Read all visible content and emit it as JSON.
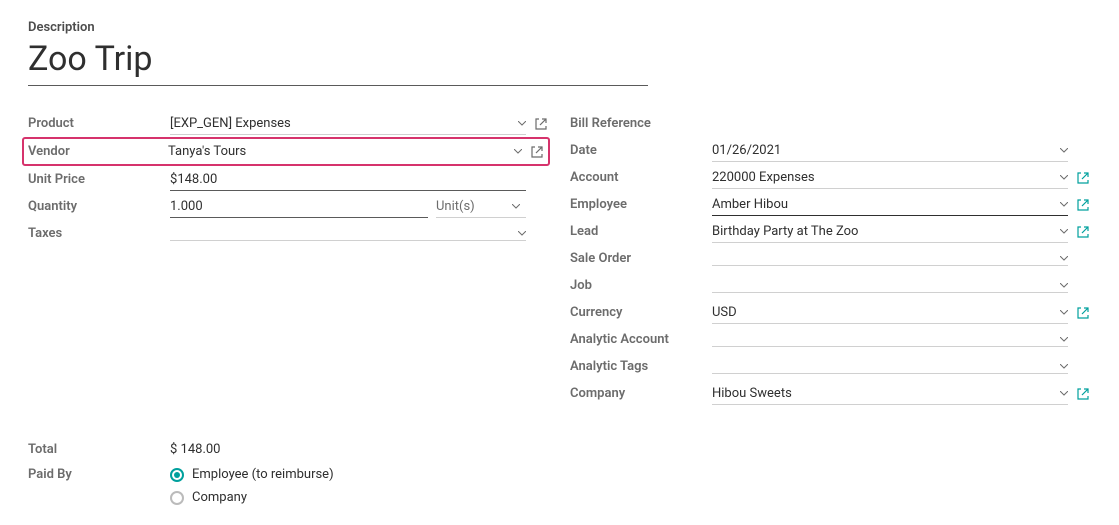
{
  "header": {
    "description_label": "Description",
    "title": "Zoo Trip"
  },
  "left": {
    "product": {
      "label": "Product",
      "value": "[EXP_GEN] Expenses"
    },
    "vendor": {
      "label": "Vendor",
      "value": "Tanya's Tours"
    },
    "unit_price": {
      "label": "Unit Price",
      "prefix": "$",
      "value": "148.00"
    },
    "quantity": {
      "label": "Quantity",
      "value": "1.000",
      "unit": "Unit(s)"
    },
    "taxes": {
      "label": "Taxes",
      "value": ""
    }
  },
  "right": {
    "bill_reference": {
      "label": "Bill Reference",
      "value": ""
    },
    "date": {
      "label": "Date",
      "value": "01/26/2021"
    },
    "account": {
      "label": "Account",
      "value": "220000 Expenses"
    },
    "employee": {
      "label": "Employee",
      "value": "Amber Hibou"
    },
    "lead": {
      "label": "Lead",
      "value": "Birthday Party at The Zoo"
    },
    "sale_order": {
      "label": "Sale Order",
      "value": ""
    },
    "job": {
      "label": "Job",
      "value": ""
    },
    "currency": {
      "label": "Currency",
      "value": "USD"
    },
    "analytic_account": {
      "label": "Analytic Account",
      "value": ""
    },
    "analytic_tags": {
      "label": "Analytic Tags",
      "value": ""
    },
    "company": {
      "label": "Company",
      "value": "Hibou Sweets"
    }
  },
  "footer": {
    "total": {
      "label": "Total",
      "value": "$ 148.00"
    },
    "paid_by": {
      "label": "Paid By",
      "options": [
        {
          "label": "Employee (to reimburse)",
          "checked": true
        },
        {
          "label": "Company",
          "checked": false
        }
      ]
    }
  }
}
